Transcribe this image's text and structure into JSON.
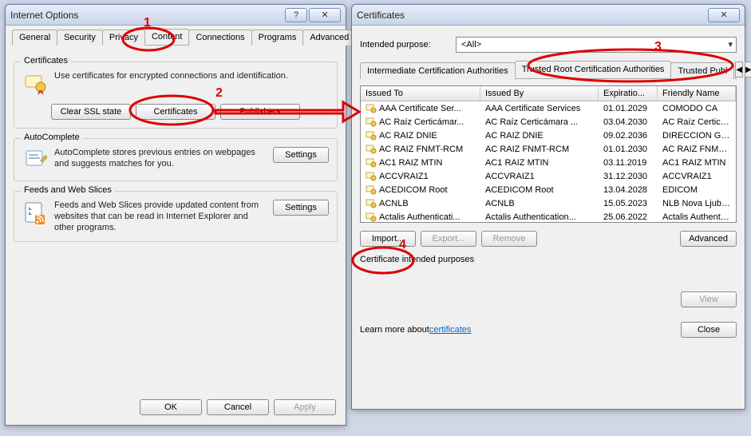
{
  "options_window": {
    "title": "Internet Options",
    "tabs": [
      "General",
      "Security",
      "Privacy",
      "Content",
      "Connections",
      "Programs",
      "Advanced"
    ],
    "active_tab_index": 3,
    "help_btn": "?",
    "close_btn": "✕",
    "certificates_group": {
      "title": "Certificates",
      "text": "Use certificates for encrypted connections and identification.",
      "btn_clear_ssl": "Clear SSL state",
      "btn_certs": "Certificates",
      "btn_pub": "Publishers"
    },
    "autocomplete_group": {
      "title": "AutoComplete",
      "text": "AutoComplete stores previous entries on webpages and suggests matches for you.",
      "btn_settings": "Settings"
    },
    "feeds_group": {
      "title": "Feeds and Web Slices",
      "text": "Feeds and Web Slices provide updated content from websites that can be read in Internet Explorer and other programs.",
      "btn_settings": "Settings"
    },
    "footer": {
      "ok": "OK",
      "cancel": "Cancel",
      "apply": "Apply"
    }
  },
  "certs_window": {
    "title": "Certificates",
    "close_btn": "✕",
    "intended_label": "Intended purpose:",
    "intended_value": "<All>",
    "tabs": [
      "Intermediate Certification Authorities",
      "Trusted Root Certification Authorities",
      "Trusted Publ"
    ],
    "active_tab_index": 1,
    "scroll_left": "◀",
    "scroll_right": "▶",
    "columns": {
      "issued_to": "Issued To",
      "issued_by": "Issued By",
      "exp": "Expiratio...",
      "friendly": "Friendly Name"
    },
    "rows": [
      {
        "issued_to": "AAA Certificate Ser...",
        "issued_by": "AAA Certificate Services",
        "exp": "01.01.2029",
        "friendly": "COMODO CA"
      },
      {
        "issued_to": "AC Raíz Certicámar...",
        "issued_by": "AC Raíz Certicámara ...",
        "exp": "03.04.2030",
        "friendly": "AC Raíz Certicá..."
      },
      {
        "issued_to": "AC RAIZ DNIE",
        "issued_by": "AC RAIZ DNIE",
        "exp": "09.02.2036",
        "friendly": "DIRECCION GEN..."
      },
      {
        "issued_to": "AC RAIZ FNMT-RCM",
        "issued_by": "AC RAIZ FNMT-RCM",
        "exp": "01.01.2030",
        "friendly": "AC RAIZ FNMT-..."
      },
      {
        "issued_to": "AC1 RAIZ MTIN",
        "issued_by": "AC1 RAIZ MTIN",
        "exp": "03.11.2019",
        "friendly": "AC1 RAIZ MTIN"
      },
      {
        "issued_to": "ACCVRAIZ1",
        "issued_by": "ACCVRAIZ1",
        "exp": "31.12.2030",
        "friendly": "ACCVRAIZ1"
      },
      {
        "issued_to": "ACEDICOM Root",
        "issued_by": "ACEDICOM Root",
        "exp": "13.04.2028",
        "friendly": "EDICOM"
      },
      {
        "issued_to": "ACNLB",
        "issued_by": "ACNLB",
        "exp": "15.05.2023",
        "friendly": "NLB Nova Ljublja..."
      },
      {
        "issued_to": "Actalis Authenticati...",
        "issued_by": "Actalis Authentication...",
        "exp": "25.06.2022",
        "friendly": "Actalis Authentic..."
      }
    ],
    "btn_import": "Import...",
    "btn_export": "Export...",
    "btn_remove": "Remove",
    "btn_advanced": "Advanced",
    "purposes_label": "Certificate intended purposes",
    "btn_view": "View",
    "learn_prefix": "Learn more about ",
    "learn_link": "certificates",
    "btn_close": "Close"
  },
  "annotations": {
    "n1": "1",
    "n2": "2",
    "n3": "3",
    "n4": "4"
  }
}
